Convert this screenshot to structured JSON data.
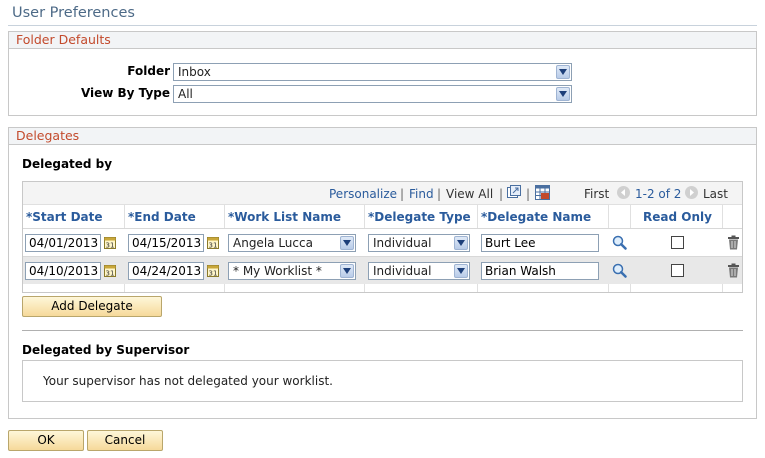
{
  "page": {
    "title": "User Preferences"
  },
  "folder_defaults": {
    "header": "Folder Defaults",
    "folder": {
      "label": "Folder",
      "value": "Inbox"
    },
    "view_by_type": {
      "label": "View By Type",
      "value": "All"
    }
  },
  "delegates": {
    "header": "Delegates",
    "delegated_by_label": "Delegated by",
    "nav": {
      "personalize": "Personalize",
      "find": "Find",
      "view_all": "View All",
      "first": "First",
      "range": "1-2 of 2",
      "last": "Last",
      "sep": "|"
    },
    "columns": {
      "start_date": "*Start Date",
      "end_date": "*End Date",
      "work_list_name": "*Work List Name",
      "delegate_type": "*Delegate Type",
      "delegate_name": "*Delegate Name",
      "read_only": "Read Only"
    },
    "rows": [
      {
        "start_date": "04/01/2013",
        "end_date": "04/15/2013",
        "work_list_name": "Angela Lucca",
        "delegate_type": "Individual",
        "delegate_name": "Burt Lee",
        "read_only": false
      },
      {
        "start_date": "04/10/2013",
        "end_date": "04/24/2013",
        "work_list_name": "* My Worklist *",
        "delegate_type": "Individual",
        "delegate_name": "Brian Walsh",
        "read_only": false
      }
    ],
    "add_delegate_label": "Add Delegate",
    "supervisor": {
      "heading": "Delegated by Supervisor",
      "message": "Your supervisor has not delegated your worklist."
    }
  },
  "footer": {
    "ok_label": "OK",
    "cancel_label": "Cancel"
  },
  "colors": {
    "accent_title": "#4d6a87",
    "group_header": "#c34a2c",
    "link": "#2a5b9c",
    "button": "#f6d99a"
  }
}
